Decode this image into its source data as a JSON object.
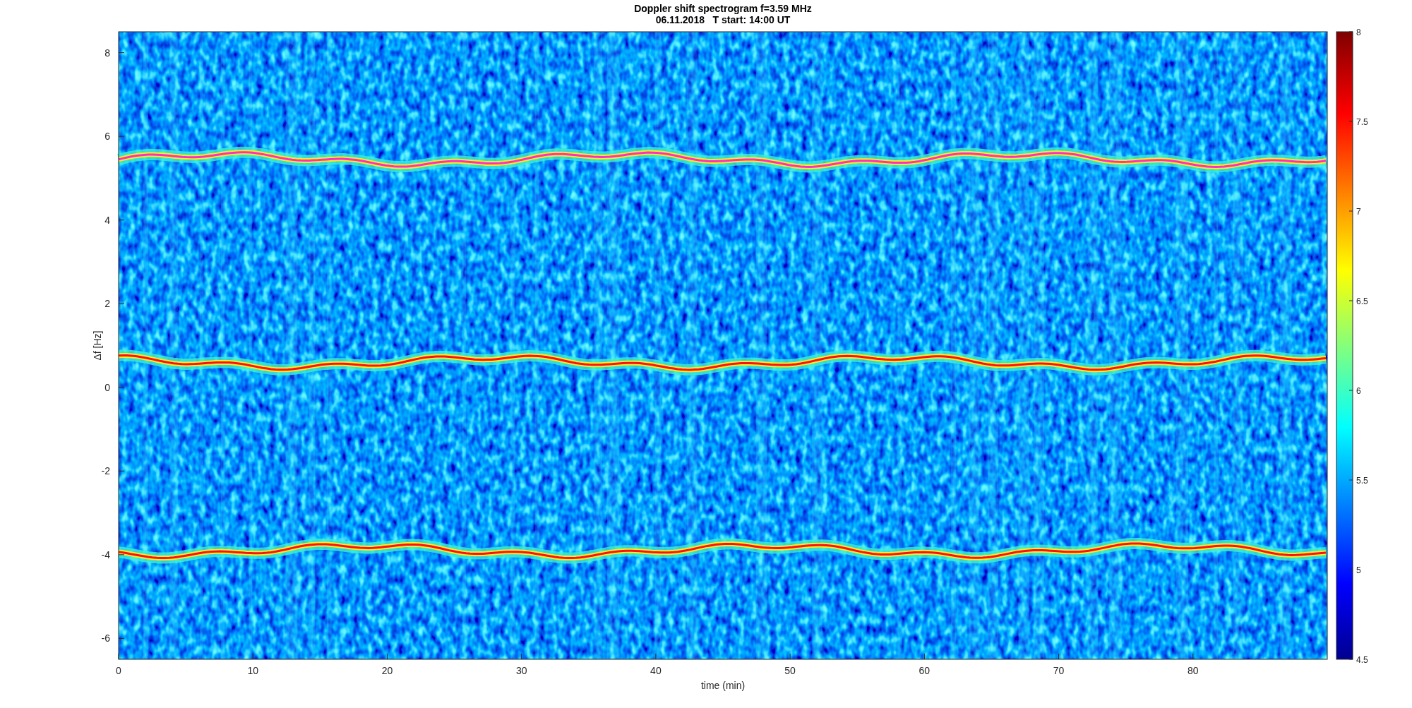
{
  "figure": {
    "title": [
      "Doppler shift spectrogram f=3.59 MHz",
      "06.11.2018   T start: 14:00 UT"
    ],
    "axes": {
      "xlabel": "time (min)",
      "ylabel": "Δf [Hz]",
      "xticks": [
        "0",
        "10",
        "20",
        "30",
        "40",
        "50",
        "60",
        "70",
        "80"
      ],
      "yticks": [
        "8",
        "6",
        "4",
        "2",
        "0",
        "-2",
        "-4",
        "-6"
      ]
    },
    "colorbar": {
      "ticks": [
        "8",
        "7.5",
        "7",
        "6.5",
        "6",
        "5.5",
        "5",
        "4.5"
      ]
    }
  }
}
